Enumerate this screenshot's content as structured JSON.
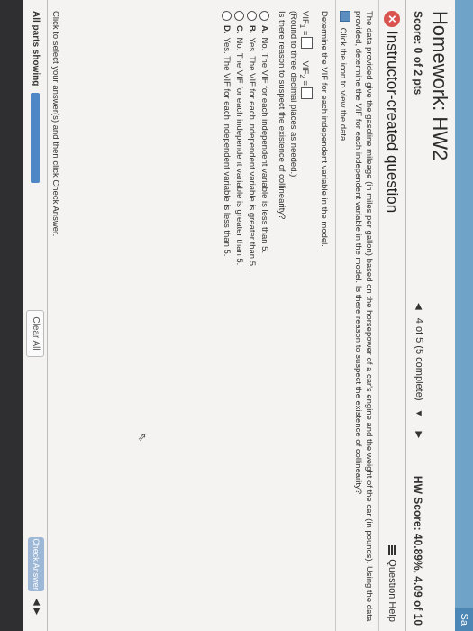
{
  "header": {
    "corner_button": "Sa",
    "title": "Homework: HW2",
    "score": "Score: 0 of 2 pts",
    "nav_text": "4 of 5 (5 complete)",
    "hw_score": "HW Score: 40.89%, 4.09 of 10"
  },
  "question": {
    "title": "Instructor-created question",
    "help_label": "Question Help",
    "prompt_line1": "The data provided give the gasoline mileage (in miles per gallon) based on the horsepower of a car's engine and the weight of the car (in pounds). Using the data",
    "prompt_line2": "provided, determine the VIF for each independent variable in the model. Is there reason to suspect the existence of collinearity?",
    "data_link": "Click the icon to view the data.",
    "determine": "Determine the VIF for each independent variable in the model.",
    "vif1_label": "VIF",
    "vif1_sub": "1",
    "vif2_label": "VIF",
    "vif2_sub": "2",
    "round_note": "(Round to three decimal places as needed.)",
    "collinearity_q": "Is there reason to suspect the existence of collinearity?",
    "options": [
      {
        "letter": "A.",
        "text": "No. The VIF for each independent variable is less than 5."
      },
      {
        "letter": "B.",
        "text": "Yes. The VIF for each independent variable is greater than 5."
      },
      {
        "letter": "C.",
        "text": "No. The VIF for each independent variable is greater than 5."
      },
      {
        "letter": "D.",
        "text": "Yes. The VIF for each independent variable is less than 5."
      }
    ]
  },
  "footer": {
    "instruction": "Click to select your answer(s) and then click Check Answer.",
    "parts": "All parts showing",
    "clear_all": "Clear All",
    "check_answer": "Check Answer"
  }
}
